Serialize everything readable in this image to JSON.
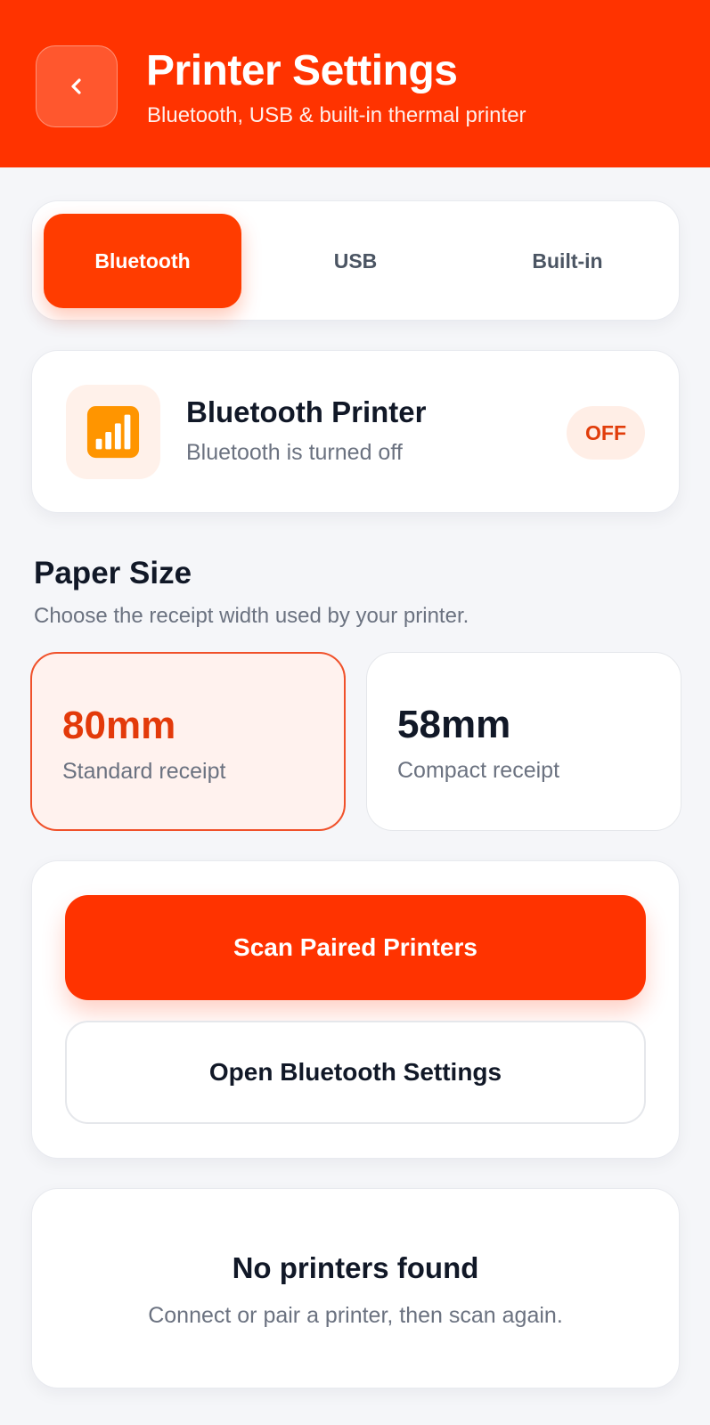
{
  "header": {
    "title": "Printer Settings",
    "subtitle": "Bluetooth, USB & built-in thermal printer",
    "back_icon": "chevron-left-icon"
  },
  "tabs": [
    {
      "label": "Bluetooth",
      "active": true
    },
    {
      "label": "USB",
      "active": false
    },
    {
      "label": "Built-in",
      "active": false
    }
  ],
  "status": {
    "icon": "signal-bars-icon",
    "title": "Bluetooth Printer",
    "subtitle": "Bluetooth is turned off",
    "badge": "OFF"
  },
  "paper": {
    "title": "Paper Size",
    "subtitle": "Choose the receipt width used by your printer.",
    "options": [
      {
        "value": "80mm",
        "label": "Standard receipt",
        "selected": true
      },
      {
        "value": "58mm",
        "label": "Compact receipt",
        "selected": false
      }
    ]
  },
  "actions": {
    "scan_label": "Scan Paired Printers",
    "open_label": "Open Bluetooth Settings"
  },
  "empty": {
    "title": "No printers found",
    "subtitle": "Connect or pair a printer, then scan again."
  },
  "colors": {
    "brand": "#ff3300",
    "background": "#f5f6f9",
    "badge_bg": "#ffeee6",
    "selected_card_bg": "#fff2ee",
    "icon_bg": "#fff1ea"
  }
}
